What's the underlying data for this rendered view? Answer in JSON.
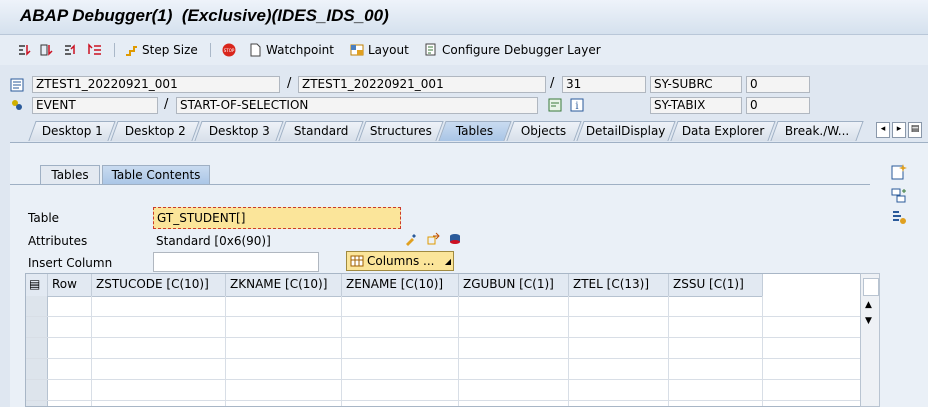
{
  "window": {
    "title": "ABAP Debugger(1)  (Exclusive)(IDES_IDS_00)"
  },
  "toolbar": {
    "step_size": "Step Size",
    "watchpoint": "Watchpoint",
    "layout": "Layout",
    "configure": "Configure Debugger Layer"
  },
  "context": {
    "program": "ZTEST1_20220921_001",
    "include": "ZTEST1_20220921_001",
    "line": "31",
    "sy_subrc_label": "SY-SUBRC",
    "sy_subrc_value": "0",
    "event_type": "EVENT",
    "event_name": "START-OF-SELECTION",
    "sy_tabix_label": "SY-TABIX",
    "sy_tabix_value": "0"
  },
  "tabs": [
    "Desktop 1",
    "Desktop 2",
    "Desktop 3",
    "Standard",
    "Structures",
    "Tables",
    "Objects",
    "DetailDisplay",
    "Data Explorer",
    "Break./W..."
  ],
  "active_tab": "Tables",
  "subtabs": [
    "Tables",
    "Table Contents"
  ],
  "table_tool": {
    "table_label": "Table",
    "table_value": "GT_STUDENT[]",
    "attributes_label": "Attributes",
    "attributes_value": "Standard [0x6(90)]",
    "insert_column_label": "Insert Column",
    "insert_column_value": "",
    "columns_button": "Columns ..."
  },
  "grid": {
    "columns": [
      "Row",
      "ZSTUCODE [C(10)]",
      "ZKNAME [C(10)]",
      "ZENAME [C(10)]",
      "ZGUBUN [C(1)]",
      "ZTEL [C(13)]",
      "ZSSU [C(1)]"
    ],
    "row_count_visible": 6
  },
  "colors": {
    "accent": "#a9c5e6",
    "highlight_field": "#fbe59a",
    "stop": "#d9261c"
  }
}
